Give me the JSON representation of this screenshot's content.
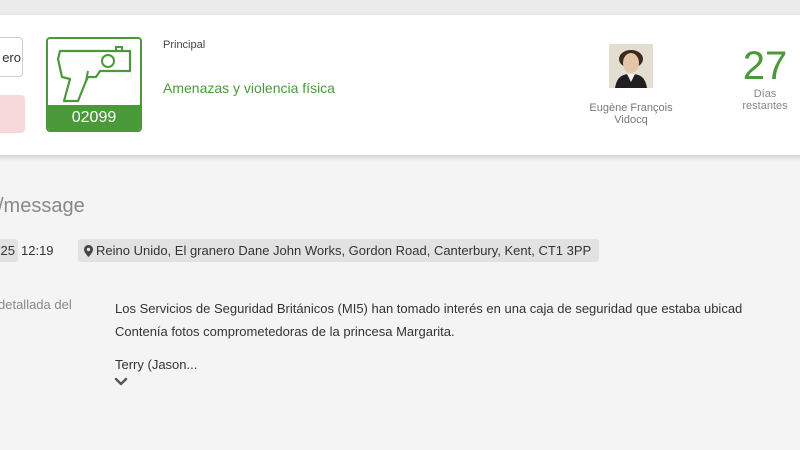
{
  "header": {
    "partial_button_text": "ero",
    "case": {
      "number": "02099",
      "icon": "gun-icon"
    },
    "category": {
      "label": "Principal",
      "name": "Amenazas y violencia física"
    },
    "agent": {
      "name_line1": "Eugène François",
      "name_line2": "Vidocq"
    },
    "days": {
      "value": "27",
      "label_line1": "Días",
      "label_line2": "restantes"
    }
  },
  "page_title": "/message",
  "meta": {
    "date_partial": "25",
    "time": "12:19",
    "location": "Reino Unido, El granero Dane John Works, Gordon Road, Canterbury, Kent, CT1 3PP",
    "location_icon": "map-pin-icon"
  },
  "description": {
    "label": "detallada del",
    "line1": "Los Servicios de Seguridad Británicos (MI5) han tomado interés en una caja de seguridad que estaba ubicad",
    "line2": "Contenía fotos comprometedoras de la princesa Margarita.",
    "more": "Terry (Jason..."
  },
  "colors": {
    "accent": "#4a9a3a",
    "danger_light": "#f7d9db",
    "chip_bg": "#e2e2e2"
  }
}
